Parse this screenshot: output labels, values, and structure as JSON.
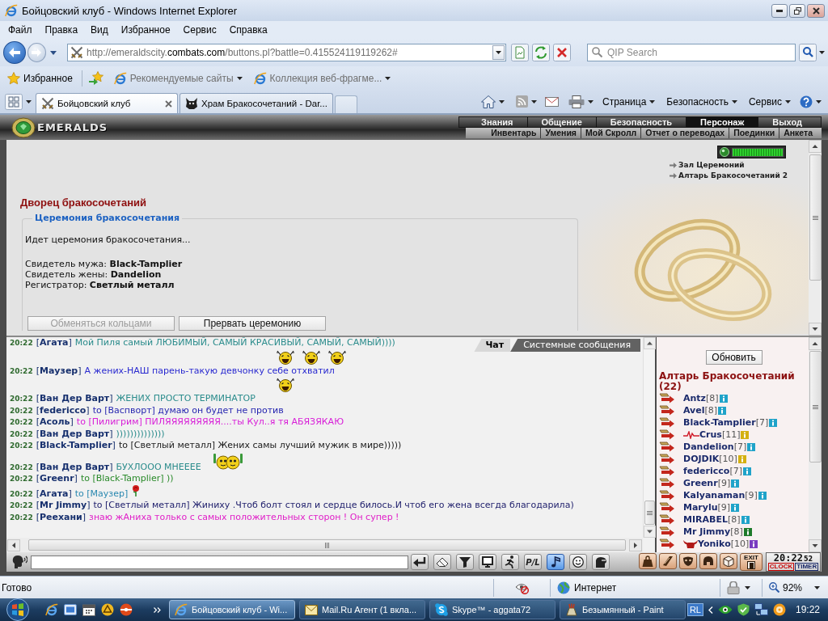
{
  "window": {
    "title": "Бойцовский клуб - Windows Internet Explorer"
  },
  "menu_bar": [
    "Файл",
    "Правка",
    "Вид",
    "Избранное",
    "Сервис",
    "Справка"
  ],
  "address_bar": {
    "url_start": "http://emeraldscity.",
    "url_domain": "combats.com",
    "url_end": "/buttons.pl?battle=0.415524119119262#",
    "search_placeholder": "QIP Search"
  },
  "favorites_bar": {
    "favorites": "Избранное",
    "links": [
      "Рекомендуемые сайты",
      "Коллекция веб-фрагме..."
    ]
  },
  "tabs": [
    {
      "label": "Бойцовский клуб",
      "selected": true
    },
    {
      "label": "Храм Бракосочетаний - Dar...",
      "selected": false
    }
  ],
  "command_bar": [
    "Страница",
    "Безопасность",
    "Сервис"
  ],
  "game": {
    "logo": "EMERALDS",
    "main_menu": [
      {
        "label": "Знания",
        "selected": false
      },
      {
        "label": "Общение",
        "selected": false
      },
      {
        "label": "Безопасность",
        "selected": false
      },
      {
        "label": "Персонаж",
        "selected": true
      },
      {
        "label": "Выход",
        "selected": false
      }
    ],
    "sub_menu": [
      "Инвентарь",
      "Умения",
      "Мой Скролл",
      "Отчет о переводах",
      "Поединки",
      "Анкета"
    ],
    "room": {
      "health": {
        "level": 1
      },
      "exits": [
        "Зал Церемоний",
        "Алтарь Бракосочетаний 2"
      ],
      "title": "Дворец бракосочетаний",
      "ceremony": {
        "legend": "Церемония бракосочетания",
        "status": "Идет церемония бракосочетания...",
        "roles": [
          "Свидетель мужа: **Black-Tamplier**",
          "Свидетель жены: **Dandelion**",
          "Регистратор: **Светлый металл**"
        ],
        "actions": [
          {
            "label": "Обменяться кольцами",
            "disabled": true
          },
          {
            "label": "Прервать церемонию",
            "disabled": false
          }
        ]
      }
    },
    "chat": {
      "tabs": [
        {
          "label": "Чат",
          "selected": true
        },
        {
          "label": "Системные сообщения",
          "selected": false
        }
      ],
      "messages": [
        {
          "time": "20:22",
          "author": "[**Агата**]",
          "text": "Мой Пиля самый ЛЮБИМЫЙ, САМЫЙ КРАСИВЫЙ, САМЫЙ, САМЫЙ))))",
          "color": "#2b8c8c",
          "smileys": [
            {
              "kind": "laugh"
            },
            {
              "kind": "laugh"
            },
            {
              "kind": "laugh"
            }
          ],
          "smileys_below": true
        },
        {
          "time": "20:22",
          "author": "[**Маузер**]",
          "text": "А жених-НАШ парень-такую девчонку себе отхватил",
          "color": "#2a2ad0",
          "smileys": [
            {
              "kind": "laugh"
            }
          ],
          "smileys_below": true
        },
        {
          "time": "20:22",
          "author": "[**Ван Дер Варт**]",
          "text": "ЖЕНИХ ПРОСТО ТЕРМИНАТОР",
          "color": "#2b8c8c"
        },
        {
          "time": "20:22",
          "author": "[**federicco**]",
          "text": "to [Васпворт] думаю он будет не против",
          "color": "#2626b0"
        },
        {
          "time": "20:22",
          "author": "[**Асоль**]",
          "text": "to [Пилигрим] ПИЛЯЯЯЯЯЯЯЯЯ....ты Кул..я тя АБЯЗЯКАЮ",
          "color": "#d81ed8"
        },
        {
          "time": "20:22",
          "author": "[**Ван Дер Варт**]",
          "text": "))))))))))))))",
          "color": "#2b8c8c"
        },
        {
          "time": "20:22",
          "author": "[**Black-Tamplier**]",
          "text": "to [Светлый металл] Жених самы лучший мужик в мире)))))",
          "color": "#202020"
        },
        {
          "time": "20:22",
          "author": "[**Ван Дер Варт**]",
          "text": "БУХЛООО МНЕЕЕЕ",
          "color": "#2b8c8c",
          "smileys": [
            {
              "kind": "cheers"
            }
          ],
          "smileys_below": false
        },
        {
          "time": "20:22",
          "author": "[**Greenr**]",
          "text": "to [Black-Tamplier] ))",
          "color": "#2a8a2a"
        },
        {
          "time": "20:22",
          "author": "[**Агата**]",
          "text": "to [Маузер]",
          "color": "#2a88b0",
          "smileys": [
            {
              "kind": "rose"
            }
          ],
          "smileys_below": false
        },
        {
          "time": "20:22",
          "author": "[**Mr Jimmy**]",
          "text": "to [Светлый металл] Жиниху .Чтоб болт стоял и сердце билось.И чтоб его жена всегда благодарила)",
          "color": "#22226e"
        },
        {
          "time": "20:22",
          "author": "[**Реехани**]",
          "text": "знаю жАниха только с самых положительных сторон ! Он супер !",
          "color": "#e020c8"
        }
      ]
    },
    "online": {
      "refresh": "Обновить",
      "title": "Алтарь Бракосочетаний (22)",
      "users": [
        {
          "name": "Antz",
          "rank": "[8]",
          "color": "#1fa3c9"
        },
        {
          "name": "Avel",
          "rank": "[8]",
          "color": "#1fa3c9"
        },
        {
          "name": "Black-Tamplier",
          "rank": "[7]",
          "color": "#1fa3c9"
        },
        {
          "name": "Crus",
          "rank": "[11]",
          "color": "#d4b010",
          "emblem": {
            "kind": "squiggle"
          }
        },
        {
          "name": "Dandelion",
          "rank": "[7]",
          "color": "#1fa3c9"
        },
        {
          "name": "DOJDIK",
          "rank": "[10]",
          "color": "#d4b010"
        },
        {
          "name": "federicco",
          "rank": "[7]",
          "color": "#1fa3c9"
        },
        {
          "name": "Greenr",
          "rank": "[9]",
          "color": "#1fa3c9"
        },
        {
          "name": "Kalyanaman",
          "rank": "[9]",
          "color": "#1fa3c9"
        },
        {
          "name": "Marylu",
          "rank": "[9]",
          "color": "#1fa3c9"
        },
        {
          "name": "MIRABEL",
          "rank": "[8]",
          "color": "#1fa3c9"
        },
        {
          "name": "Mr Jimmy",
          "rank": "[8]",
          "color": "#1e7a2a"
        },
        {
          "name": "Yoniko",
          "rank": "[10]",
          "color": "#7a3cc0",
          "emblem": {
            "kind": "horns"
          }
        }
      ]
    },
    "toolbar": {
      "buttons": [
        {
          "kind": "enter",
          "on": false
        },
        {
          "kind": "eraser",
          "on": false
        },
        {
          "kind": "filter",
          "on": false
        },
        {
          "kind": "monitor",
          "on": false
        },
        {
          "kind": "runner",
          "on": false
        },
        {
          "kind": "text",
          "label": "P/L",
          "on": false
        },
        {
          "kind": "music",
          "on": true
        },
        {
          "kind": "smile",
          "on": false
        },
        {
          "kind": "head",
          "on": false
        }
      ],
      "shop": [
        {
          "kind": "bag"
        },
        {
          "kind": "scroll"
        },
        {
          "kind": "mask"
        },
        {
          "kind": "helmet"
        },
        {
          "kind": "box"
        },
        {
          "kind": "exit",
          "label": "EXIT"
        }
      ],
      "clock": {
        "time": "20:22",
        "seconds": "52",
        "modes": [
          {
            "label": "CLOCK",
            "selected": true
          },
          {
            "label": "TIMER",
            "selected": false
          }
        ]
      }
    }
  },
  "status_bar": {
    "text": "Готово",
    "zone": "Интернет",
    "zoom": "92%"
  },
  "taskbar": {
    "buttons": [
      {
        "kind": "browser",
        "label": "Бойцовский клуб - Wi...",
        "selected": true
      },
      {
        "kind": "mail",
        "label": "Mail.Ru Агент (1 вкла...",
        "selected": false
      },
      {
        "kind": "skype",
        "label": "Skype™ - aggata72",
        "selected": false
      },
      {
        "kind": "paint",
        "label": "Безымянный - Paint",
        "selected": false
      }
    ],
    "language": "RL",
    "time": "19:22"
  }
}
